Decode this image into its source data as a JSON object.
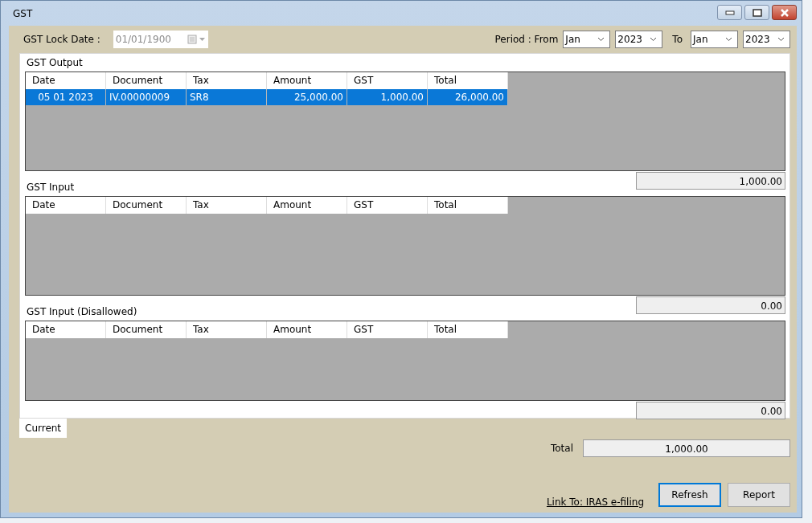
{
  "window": {
    "title": "GST"
  },
  "lock_date": {
    "label": "GST Lock Date :",
    "value": "01/01/1900",
    "disabled": true
  },
  "period": {
    "label": "Period : From",
    "from_month": "Jan",
    "from_year": "2023",
    "to_label": "To",
    "to_month": "Jan",
    "to_year": "2023"
  },
  "sections": [
    {
      "title": "GST Output",
      "columns": [
        "Date",
        "Document",
        "Tax",
        "Amount",
        "GST",
        "Total"
      ],
      "rows": [
        {
          "cells": [
            "05 01 2023",
            "IV.00000009",
            "SR8",
            "25,000.00",
            "1,000.00",
            "26,000.00"
          ],
          "selected": true
        }
      ],
      "total": "1,000.00"
    },
    {
      "title": "GST Input",
      "columns": [
        "Date",
        "Document",
        "Tax",
        "Amount",
        "GST",
        "Total"
      ],
      "total": "0.00"
    },
    {
      "title": "GST Input (Disallowed)",
      "columns": [
        "Date",
        "Document",
        "Tax",
        "Amount",
        "GST",
        "Total"
      ],
      "total": "0.00"
    }
  ],
  "tabs": [
    {
      "label": "Current",
      "selected": true
    }
  ],
  "total": {
    "label": "Total",
    "value": "1,000.00"
  },
  "link": "Link To: IRAS e-filing",
  "buttons": [
    {
      "label": "Refresh",
      "default": true
    },
    {
      "label": "Report",
      "default": false
    }
  ]
}
